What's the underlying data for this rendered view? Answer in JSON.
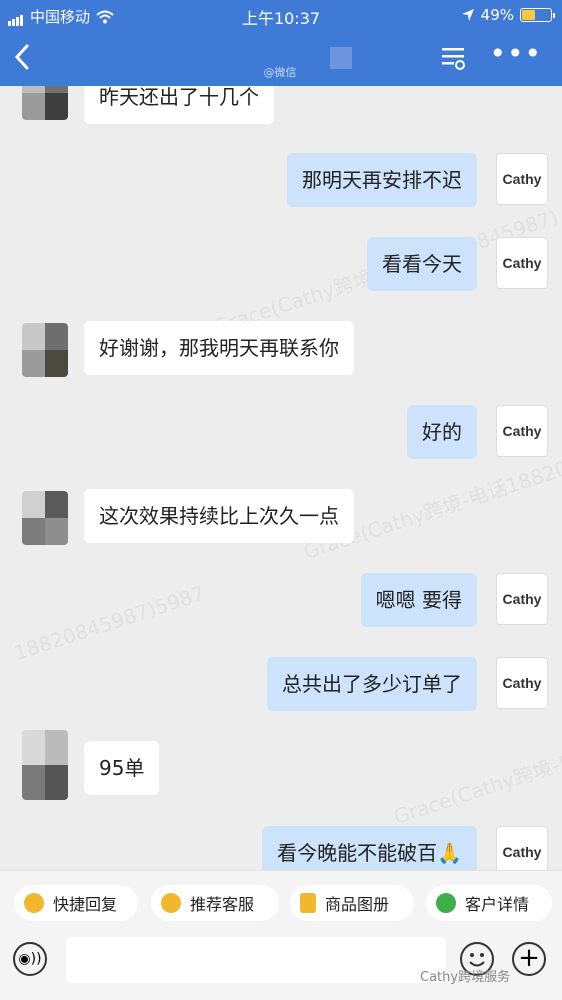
{
  "status_bar": {
    "carrier": "中国移动",
    "time": "上午10:37",
    "battery": "49%"
  },
  "nav": {
    "back_icon": "chevron-left-icon",
    "title_partial": "@微信",
    "menu_icon": "list-settings-icon",
    "more_icon": "more-dots-icon"
  },
  "agent_avatar_text": "Cathy",
  "messages": [
    {
      "side": "in",
      "text": "昨天还出了十几个"
    },
    {
      "side": "out",
      "text": "那明天再安排不迟"
    },
    {
      "side": "out",
      "text": "看看今天"
    },
    {
      "side": "in",
      "text": "好谢谢，那我明天再联系你"
    },
    {
      "side": "out",
      "text": "好的"
    },
    {
      "side": "in",
      "text": "这次效果持续比上次久一点"
    },
    {
      "side": "out",
      "text": "嗯嗯 要得"
    },
    {
      "side": "out",
      "text": "总共出了多少订单了"
    },
    {
      "side": "in",
      "text": "95单"
    },
    {
      "side": "out",
      "text": "看今晚能不能破百🙏"
    }
  ],
  "watermarks": [
    "Grace(Cathy跨境-电话18820845987)",
    "Grace(Cathy跨境-电话18820845987)",
    "Grace(Cathy跨境-电话18820845987)",
    "18820845987)5987"
  ],
  "quick_replies": [
    {
      "label": "快捷回复",
      "icon": "quick-reply-icon",
      "color": "#f3b72b"
    },
    {
      "label": "推荐客服",
      "icon": "recommend-agent-icon",
      "color": "#f3b72b"
    },
    {
      "label": "商品图册",
      "icon": "catalog-icon",
      "color": "#f3b72b"
    },
    {
      "label": "客户详情",
      "icon": "customer-detail-icon",
      "color": "#3fae4a"
    }
  ],
  "input": {
    "placeholder": "",
    "footer_watermark": "Cathy跨境服务"
  }
}
